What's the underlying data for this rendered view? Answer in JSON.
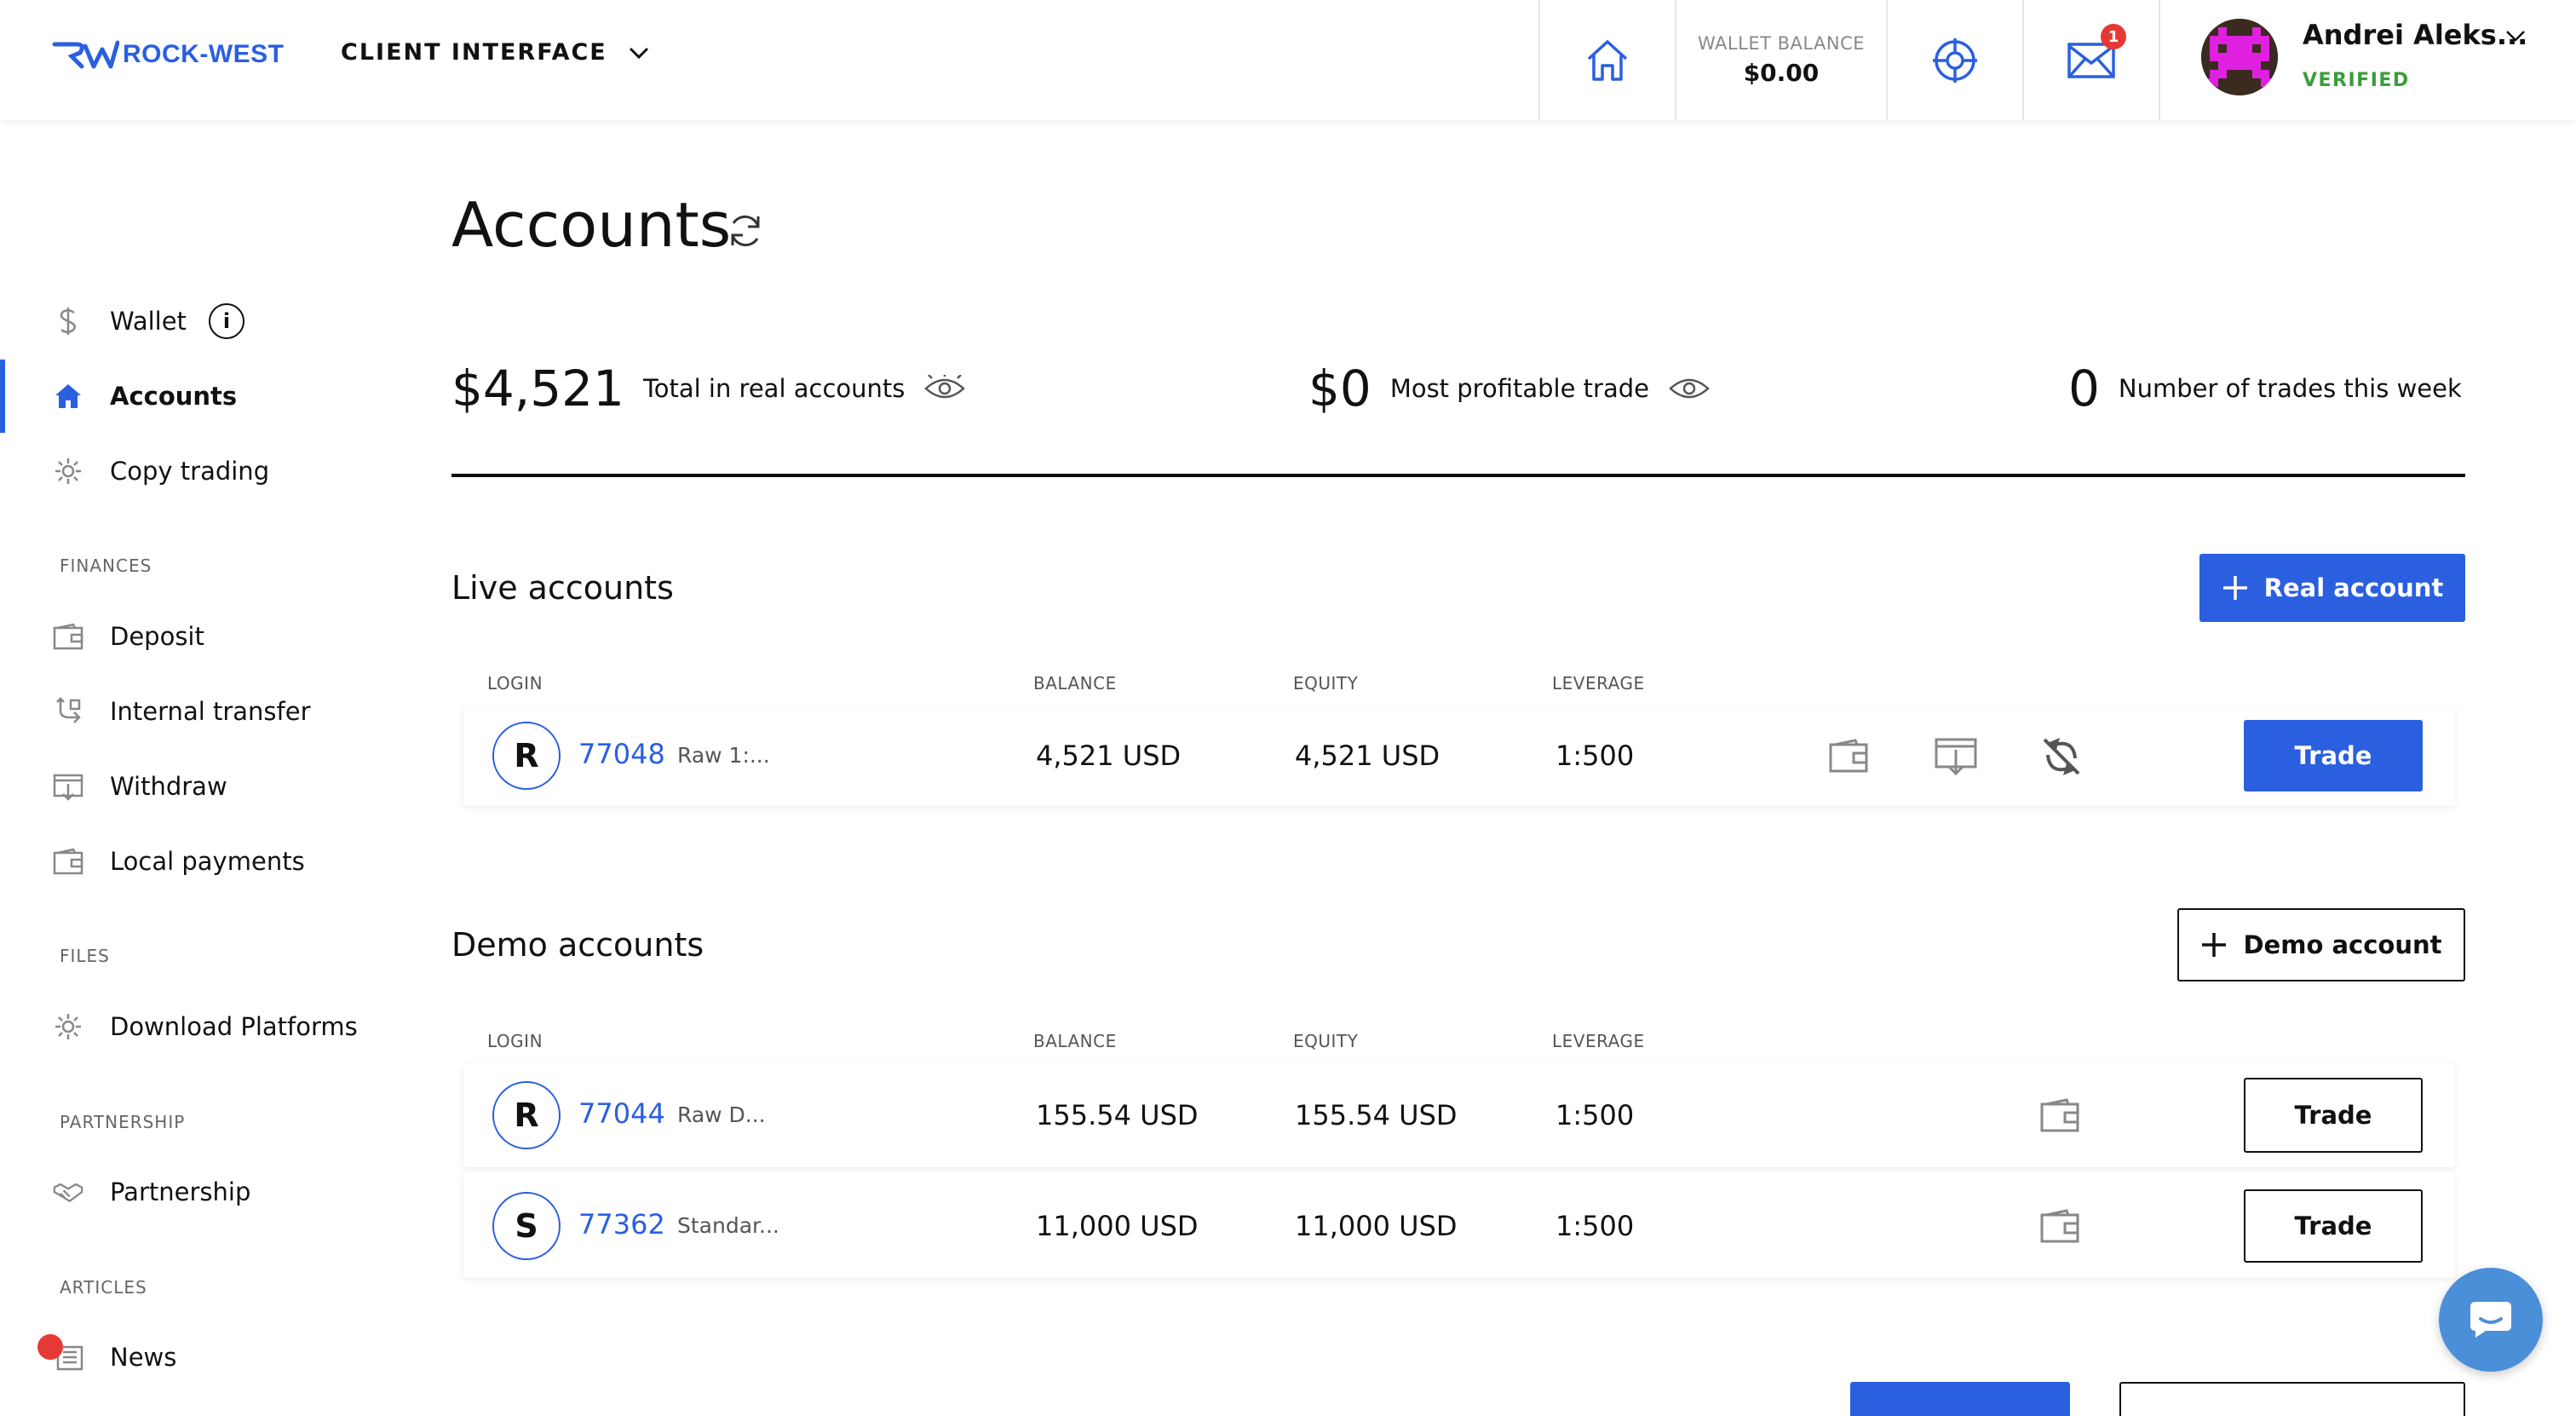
{
  "header": {
    "brand": "ROCK-WEST",
    "interface_label": "CLIENT INTERFACE",
    "wallet_balance_label": "WALLET BALANCE",
    "wallet_balance_value": "$0.00",
    "mail_badge": "1",
    "user_name": "Andrei Aleks...",
    "user_status": "VERIFIED"
  },
  "sidebar": {
    "items": [
      {
        "label": "Wallet",
        "icon": "dollar-icon"
      },
      {
        "label": "Accounts",
        "icon": "home-icon"
      },
      {
        "label": "Copy trading",
        "icon": "gear-icon"
      }
    ],
    "finances_title": "FINANCES",
    "finances": [
      {
        "label": "Deposit",
        "icon": "wallet-icon"
      },
      {
        "label": "Internal transfer",
        "icon": "transfer-icon"
      },
      {
        "label": "Withdraw",
        "icon": "withdraw-icon"
      },
      {
        "label": "Local payments",
        "icon": "wallet-icon"
      }
    ],
    "files_title": "FILES",
    "files": [
      {
        "label": "Download Platforms",
        "icon": "gear-icon"
      }
    ],
    "partnership_title": "PARTNERSHIP",
    "partnership": [
      {
        "label": "Partnership",
        "icon": "handshake-icon"
      }
    ],
    "articles_title": "ARTICLES",
    "articles": [
      {
        "label": "News",
        "icon": "news-icon"
      }
    ]
  },
  "main": {
    "title": "Accounts",
    "stats": [
      {
        "value": "$4,521",
        "label": "Total in real accounts"
      },
      {
        "value": "$0",
        "label": "Most profitable trade"
      },
      {
        "value": "0",
        "label": "Number of trades this week"
      }
    ],
    "columns": {
      "login": "LOGIN",
      "balance": "BALANCE",
      "equity": "EQUITY",
      "leverage": "LEVERAGE"
    },
    "live": {
      "title": "Live accounts",
      "add_label": "Real account",
      "rows": [
        {
          "initial": "R",
          "login": "77048",
          "type": "Raw 1:...",
          "balance": "4,521 USD",
          "equity": "4,521 USD",
          "leverage": "1:500",
          "trade": "Trade"
        }
      ]
    },
    "demo": {
      "title": "Demo accounts",
      "add_label": "Demo account",
      "rows": [
        {
          "initial": "R",
          "login": "77044",
          "type": "Raw D...",
          "balance": "155.54 USD",
          "equity": "155.54 USD",
          "leverage": "1:500",
          "trade": "Trade"
        },
        {
          "initial": "S",
          "login": "77362",
          "type": "Standar...",
          "balance": "11,000 USD",
          "equity": "11,000 USD",
          "leverage": "1:500",
          "trade": "Trade"
        }
      ]
    }
  },
  "colors": {
    "accent": "#2a5fe0",
    "verified": "#3a9d3a",
    "badge": "#e53935"
  }
}
